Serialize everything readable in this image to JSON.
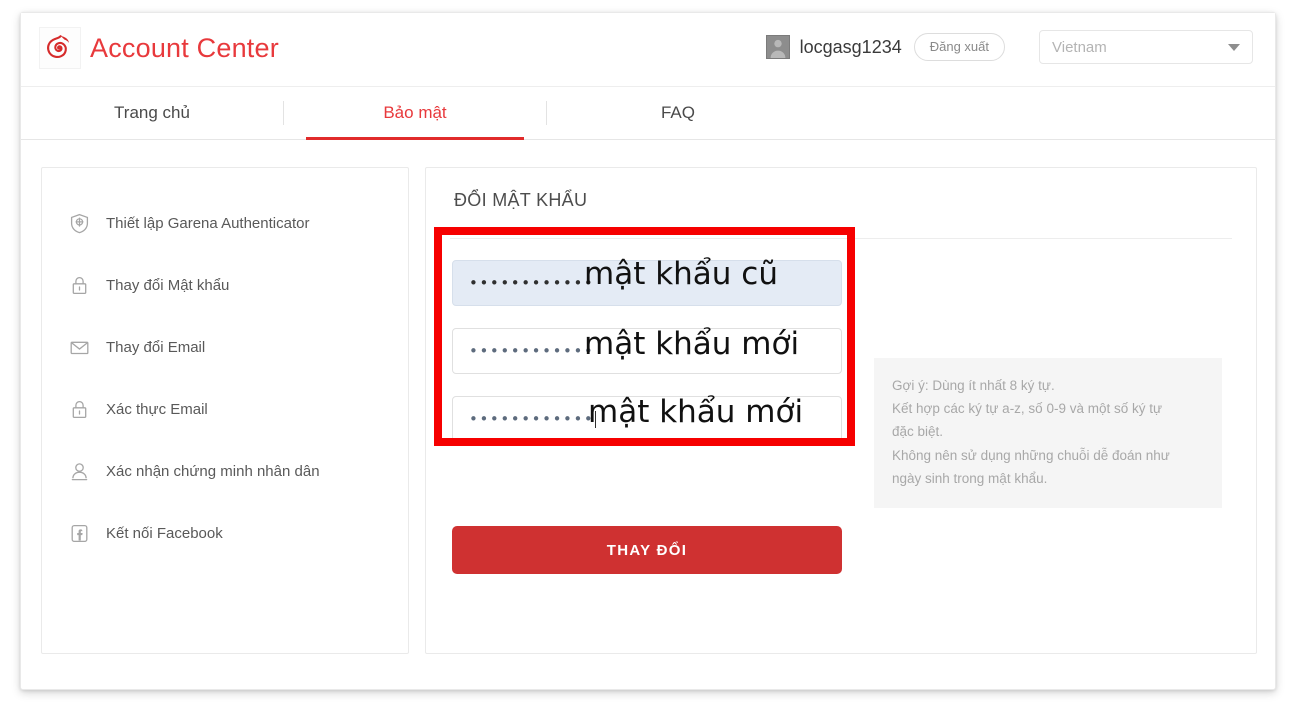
{
  "header": {
    "logo_icon": "garena-logo-icon",
    "title": "Account Center",
    "username": "locgasg1234",
    "logout_label": "Đăng xuất",
    "region_value": "Vietnam",
    "avatar_icon": "user-avatar-icon",
    "caret_icon": "chevron-down-icon"
  },
  "tabs": [
    {
      "label": "Trang chủ",
      "active": false
    },
    {
      "label": "Bảo mật",
      "active": true
    },
    {
      "label": "FAQ",
      "active": false
    }
  ],
  "sidebar": {
    "items": [
      {
        "label": "Thiết lập Garena Authenticator",
        "icon": "shield-icon"
      },
      {
        "label": "Thay đổi Mật khẩu",
        "icon": "lock-icon"
      },
      {
        "label": "Thay đổi Email",
        "icon": "envelope-icon"
      },
      {
        "label": "Xác thực Email",
        "icon": "lock-icon"
      },
      {
        "label": "Xác nhận chứng minh nhân dân",
        "icon": "person-id-icon"
      },
      {
        "label": "Kết nối Facebook",
        "icon": "facebook-icon"
      }
    ]
  },
  "main": {
    "title": "ĐỔI MẬT KHẨU",
    "fields": [
      {
        "name": "current-password",
        "value": "••••••••••••",
        "filled": true
      },
      {
        "name": "new-password",
        "value": "••••••••••••",
        "filled": false
      },
      {
        "name": "confirm-password",
        "value": "••••••••••••",
        "filled": false
      }
    ],
    "submit_label": "THAY ĐỔI",
    "hint_lines": [
      "Gợi ý: Dùng ít nhất 8 ký tự.",
      "Kết hợp các ký tự a-z, số 0-9 và một số ký tự",
      "đặc biệt.",
      "Không nên sử dụng những chuỗi dễ đoán như",
      "ngày sinh trong mật khẩu."
    ]
  },
  "annotations": {
    "box_color": "#f60000",
    "labels": [
      "mật khẩu cũ",
      "mật khẩu mới",
      "mật khẩu mới"
    ]
  },
  "colors": {
    "brand_red": "#e8393c",
    "tab_underline": "#e12b2b",
    "button_red": "#cf3131",
    "field_filled": "#e4ebf5",
    "hint_bg": "#f5f5f5"
  }
}
